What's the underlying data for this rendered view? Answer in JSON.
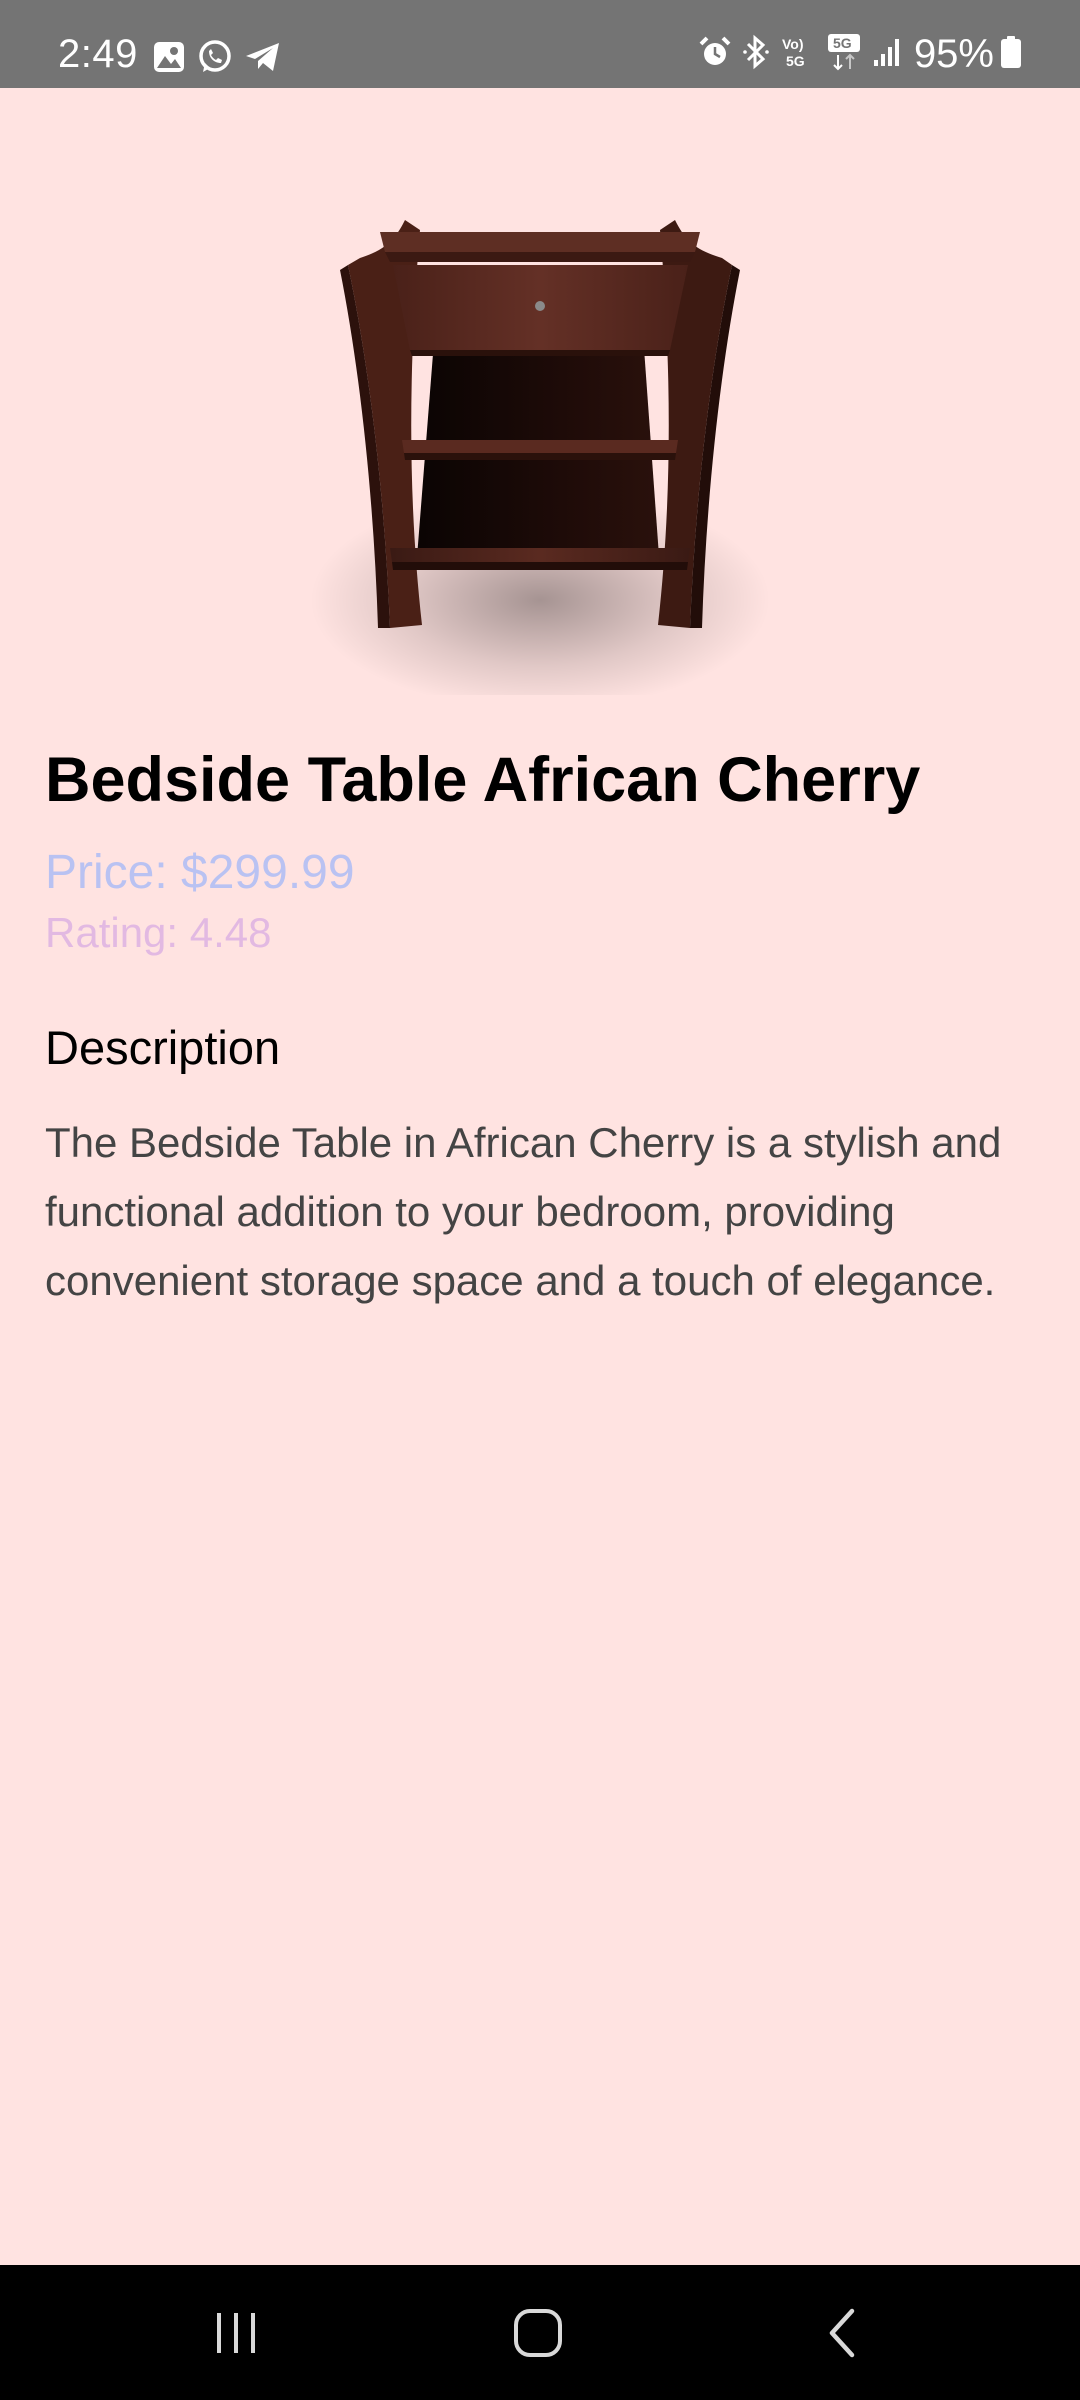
{
  "status_bar": {
    "time": "2:49",
    "battery_percent": "95%",
    "left_icons": [
      "gallery-icon",
      "whatsapp-icon",
      "telegram-icon"
    ],
    "right_icons": [
      "alarm-icon",
      "bluetooth-icon",
      "volte-5g-icon",
      "5g-data-icon",
      "signal-icon",
      "battery-icon"
    ],
    "network_labels": {
      "volte_top": "Vo)",
      "volte_bottom": "5G",
      "data_label": "5G"
    }
  },
  "product": {
    "image_alt": "Bedside Table African Cherry",
    "title": "Bedside Table African Cherry",
    "price": "Price: $299.99",
    "rating": "Rating: 4.48",
    "description_heading": "Description",
    "description": "The Bedside Table in African Cherry is a stylish and functional addition to your bedroom, providing convenient storage space and a touch of elegance."
  },
  "nav_bar": {
    "buttons": [
      "recent-apps-icon",
      "home-icon",
      "back-icon"
    ]
  },
  "colors": {
    "background": "#FFE3E1",
    "status_bar": "#747474",
    "price": "#B9C2F2",
    "rating": "#E2B9E2",
    "description_text": "#444444",
    "nav_bar": "#000000"
  }
}
